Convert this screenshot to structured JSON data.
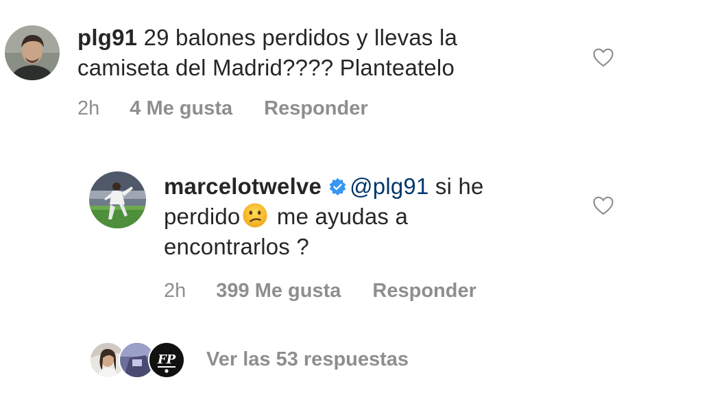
{
  "comment": {
    "username": "plg91",
    "text_line1": "29 balones perdidos y llevas la",
    "text_line2": "camiseta del Madrid???? Planteatelo",
    "time": "2h",
    "likes": "4 Me gusta",
    "reply_label": "Responder",
    "avatar_icon": "user-avatar",
    "heart_icon": "heart-outline-icon"
  },
  "reply": {
    "username": "marcelotwelve",
    "verified_icon": "verified-badge-icon",
    "mention": "@plg91",
    "text_after_mention": "si he",
    "text_line2_before_emoji": "perdido",
    "emoji_icon": "confused-face-emoji",
    "text_line2_after_emoji": "me ayudas a",
    "text_line3": "encontrarlos ?",
    "time": "2h",
    "likes": "399 Me gusta",
    "reply_label": "Responder",
    "avatar_icon": "player-avatar",
    "heart_icon": "heart-outline-icon"
  },
  "view_replies": {
    "label": "Ver las 53 respuestas",
    "avatars": [
      "replier-avatar-1",
      "replier-avatar-2",
      "replier-avatar-3"
    ],
    "logo_text": "FP"
  },
  "colors": {
    "text": "#262626",
    "secondary": "#8e8e8e",
    "mention": "#00376b",
    "verified": "#3897f0",
    "background": "#ffffff"
  }
}
